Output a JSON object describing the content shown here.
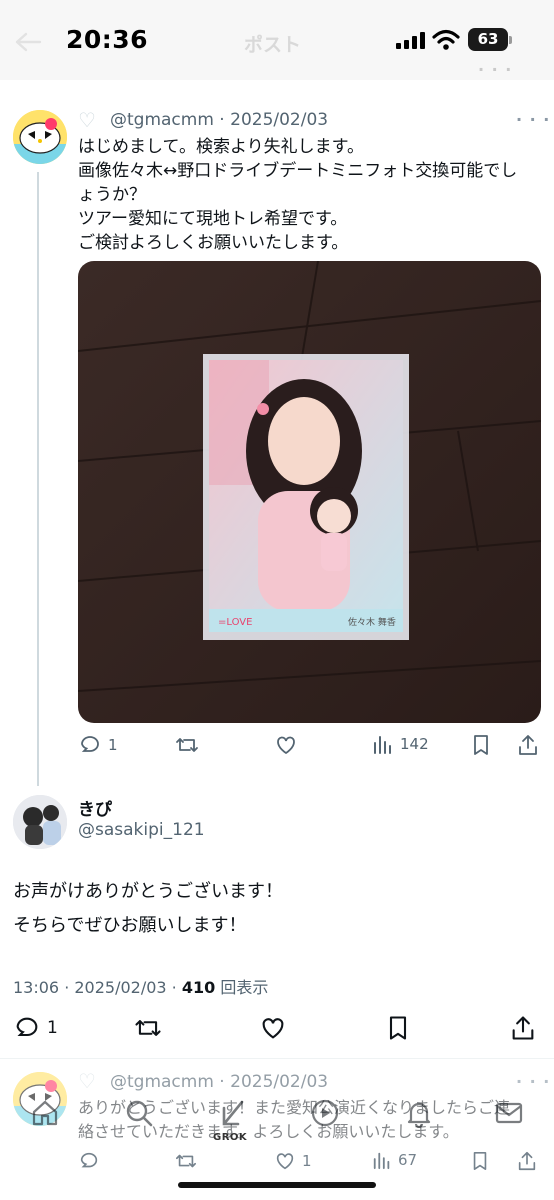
{
  "status_bar": {
    "time": "20:36",
    "battery": "63"
  },
  "header": {
    "title": "ポスト"
  },
  "tweet1": {
    "handle": "@tgmacmm",
    "date": "2025/02/03",
    "lines": [
      "はじめまして。検索より失礼します。",
      "画像佐々木↔野口ドライブデートミニフォト交換可能でし",
      "ょうか？",
      "ツアー愛知にて現地トレ希望です。",
      "ご検討よろしくお願いいたします。"
    ],
    "photo_caption": "佐々木 舞香",
    "photo_logo": "=LOVE",
    "actions": {
      "replies": "1",
      "views": "142"
    }
  },
  "tweet2": {
    "name": "きぴ",
    "handle": "@sasakipi_121",
    "lines": [
      "お声がけありがとうございます！",
      "そちらでぜひお願いします！"
    ],
    "time": "13:06",
    "date": "2025/02/03",
    "views": "410",
    "views_label": "回表示",
    "actions": {
      "replies": "1"
    }
  },
  "tweet3": {
    "handle": "@tgmacmm",
    "date": "2025/02/03",
    "lines": [
      "ありがとうございます！また愛知公演近くなりましたらご連",
      "絡させていただきます。よろしくお願いいたします。"
    ],
    "actions": {
      "likes": "1",
      "views": "67"
    }
  },
  "bottom_nav": {
    "grok_label": "GROK"
  },
  "icons": [
    "back-arrow-icon",
    "signal-icon",
    "wifi-icon",
    "battery-icon",
    "heart-icon",
    "more-icon",
    "reply-icon",
    "retweet-icon",
    "like-icon",
    "views-icon",
    "bookmark-icon",
    "share-icon",
    "home-icon",
    "search-icon",
    "grok-icon",
    "media-icon",
    "notifications-icon",
    "messages-icon"
  ],
  "colors": {
    "text": "#0f1419",
    "secondary": "#536471",
    "divider": "#eff3f4",
    "status_bg": "#f7f7f7"
  }
}
